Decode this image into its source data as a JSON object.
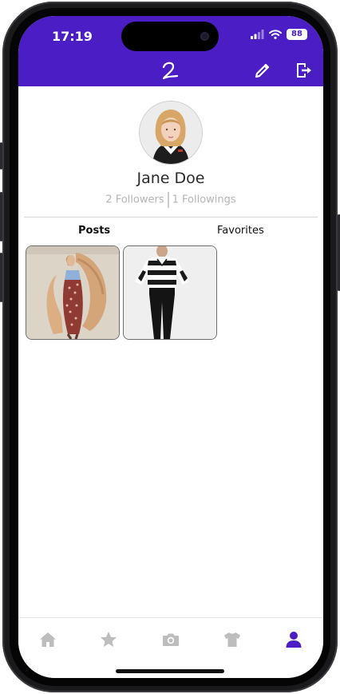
{
  "status_bar": {
    "time": "17:19",
    "battery": "88"
  },
  "header": {
    "logo_text": "2"
  },
  "profile": {
    "name": "Jane Doe",
    "followers": "2 Followers",
    "followings": "1 Followings"
  },
  "tabs": [
    {
      "label": "Posts",
      "active": true
    },
    {
      "label": "Favorites",
      "active": false
    }
  ],
  "posts": [
    {
      "description": "Model in floral slip dress with fur coat"
    },
    {
      "description": "Model in striped sweater and black jeans"
    }
  ],
  "bottom_nav": [
    {
      "icon": "home-icon",
      "active": false
    },
    {
      "icon": "star-icon",
      "active": false
    },
    {
      "icon": "camera-icon",
      "active": false
    },
    {
      "icon": "tshirt-icon",
      "active": false
    },
    {
      "icon": "user-icon",
      "active": true
    }
  ],
  "colors": {
    "accent": "#4a1ec4",
    "inactive_icon": "#bdbdbd",
    "text": "#2b2b2b",
    "muted": "#b5b5b5"
  }
}
